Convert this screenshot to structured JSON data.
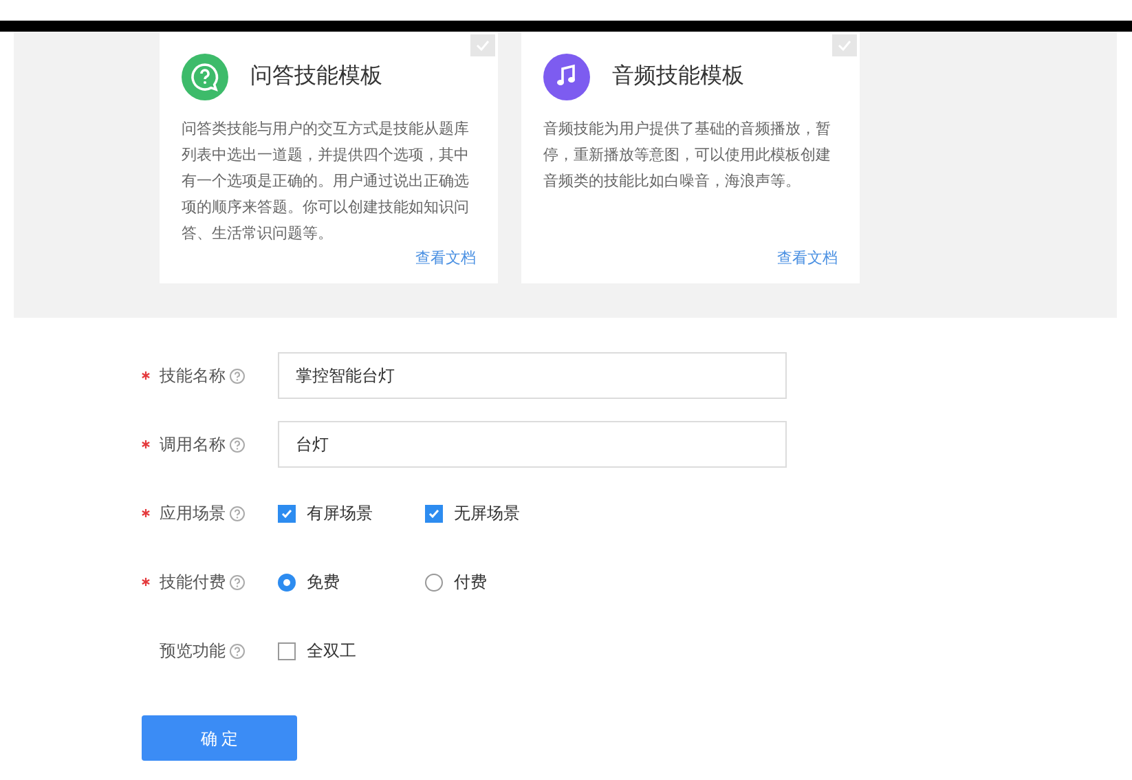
{
  "templates": [
    {
      "kind": "qa",
      "title": "问答技能模板",
      "description": "问答类技能与用户的交互方式是技能从题库列表中选出一道题，并提供四个选项，其中有一个选项是正确的。用户通过说出正确选项的顺序来答题。你可以创建技能如知识问答、生活常识问题等。",
      "link": "查看文档",
      "selected": false
    },
    {
      "kind": "audio",
      "title": "音频技能模板",
      "description": "音频技能为用户提供了基础的音频播放，暂停，重新播放等意图，可以使用此模板创建音频类的技能比如白噪音，海浪声等。",
      "link": "查看文档",
      "selected": false
    }
  ],
  "form": [
    {
      "kind": "text",
      "label": "技能名称",
      "required": true,
      "value": "掌控智能台灯"
    },
    {
      "kind": "text",
      "label": "调用名称",
      "required": true,
      "value": "台灯"
    },
    {
      "kind": "checkbox",
      "label": "应用场景",
      "required": true,
      "options": [
        {
          "label": "有屏场景",
          "checked": true
        },
        {
          "label": "无屏场景",
          "checked": true
        }
      ]
    },
    {
      "kind": "radio",
      "label": "技能付费",
      "required": true,
      "options": [
        {
          "label": "免费",
          "selected": true
        },
        {
          "label": "付费",
          "selected": false
        }
      ]
    },
    {
      "kind": "checkbox",
      "label": "预览功能",
      "required": false,
      "options": [
        {
          "label": "全双工",
          "checked": false
        }
      ]
    }
  ],
  "submit": "确 定"
}
